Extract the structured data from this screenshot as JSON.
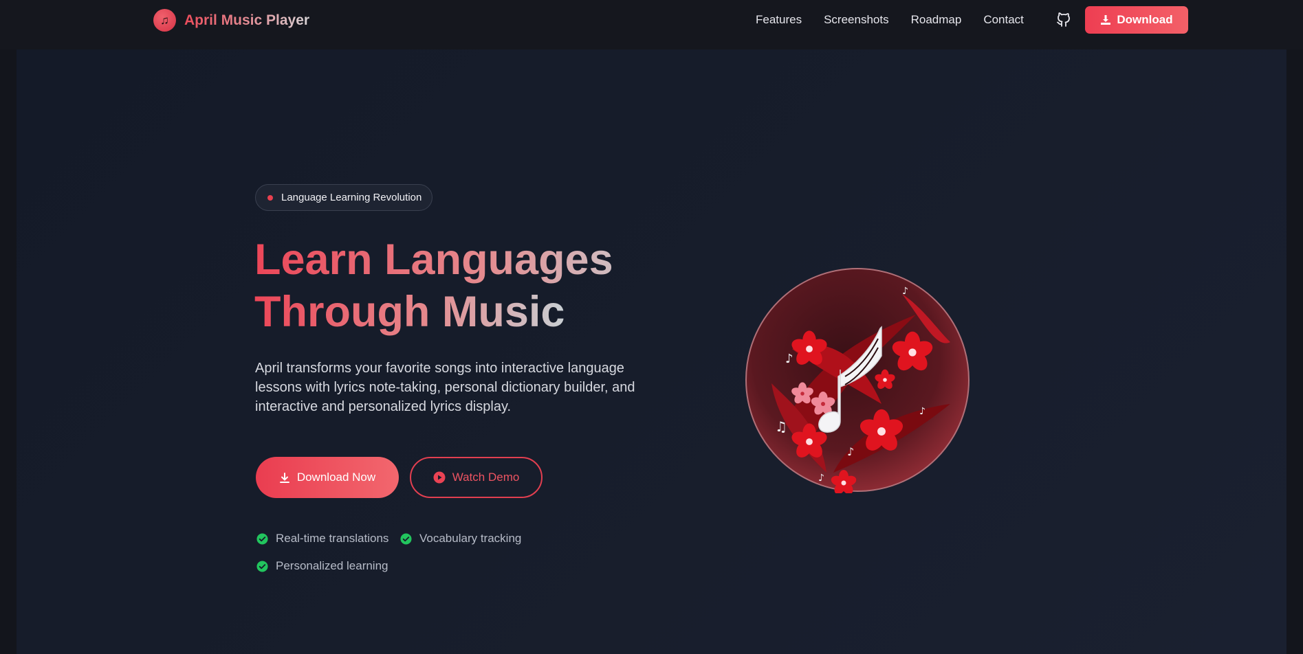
{
  "nav": {
    "brand": "April Music Player",
    "links": [
      "Features",
      "Screenshots",
      "Roadmap",
      "Contact"
    ],
    "download_label": "Download"
  },
  "hero": {
    "badge": "Language Learning Revolution",
    "headline_line1": "Learn Languages",
    "headline_line2": "Through Music",
    "description": "April transforms your favorite songs into interactive language lessons with lyrics note-taking, personal dictionary builder, and interactive and personalized lyrics display.",
    "primary_button": "Download Now",
    "secondary_button": "Watch Demo",
    "features": [
      "Real-time translations",
      "Vocabulary tracking",
      "Personalized learning"
    ]
  },
  "colors": {
    "accent": "#e8404f",
    "check": "#22c55e",
    "background": "#141a28"
  },
  "icons": {
    "brand": "music-note-icon",
    "github": "github-icon",
    "download": "download-icon",
    "play": "play-circle-icon",
    "check": "check-circle-icon"
  }
}
